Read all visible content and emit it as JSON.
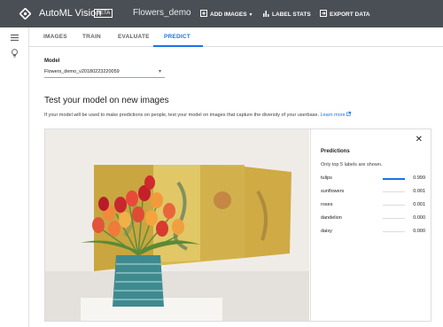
{
  "header": {
    "app_title": "AutoML Vision",
    "beta_badge": "BETA",
    "dataset_name": "Flowers_demo",
    "add_images_label": "ADD IMAGES",
    "label_stats_label": "LABEL STATS",
    "export_data_label": "EXPORT DATA"
  },
  "tabs": [
    {
      "label": "IMAGES"
    },
    {
      "label": "TRAIN"
    },
    {
      "label": "EVALUATE"
    },
    {
      "label": "PREDICT"
    }
  ],
  "active_tab": "PREDICT",
  "model": {
    "label": "Model",
    "selected": "Flowers_demo_v20180223220059"
  },
  "main": {
    "heading": "Test your model on new images",
    "description": "If your model will be used to make predictions on people, test your model on images that capture the diversity of your userbase.",
    "learn_more": "Learn more"
  },
  "predictions": {
    "title": "Predictions",
    "subtitle": "Only top 5 labels are shown.",
    "items": [
      {
        "label": "tulips",
        "score": "0.999",
        "fraction": 0.999
      },
      {
        "label": "sunflowers",
        "score": "0.001",
        "fraction": 0.001
      },
      {
        "label": "roses",
        "score": "0.001",
        "fraction": 0.001
      },
      {
        "label": "dandelion",
        "score": "0.000",
        "fraction": 0.0
      },
      {
        "label": "daisy",
        "score": "0.000",
        "fraction": 0.0
      }
    ]
  },
  "colors": {
    "topbar": "#4a4f55",
    "accent": "#1a73e8"
  }
}
